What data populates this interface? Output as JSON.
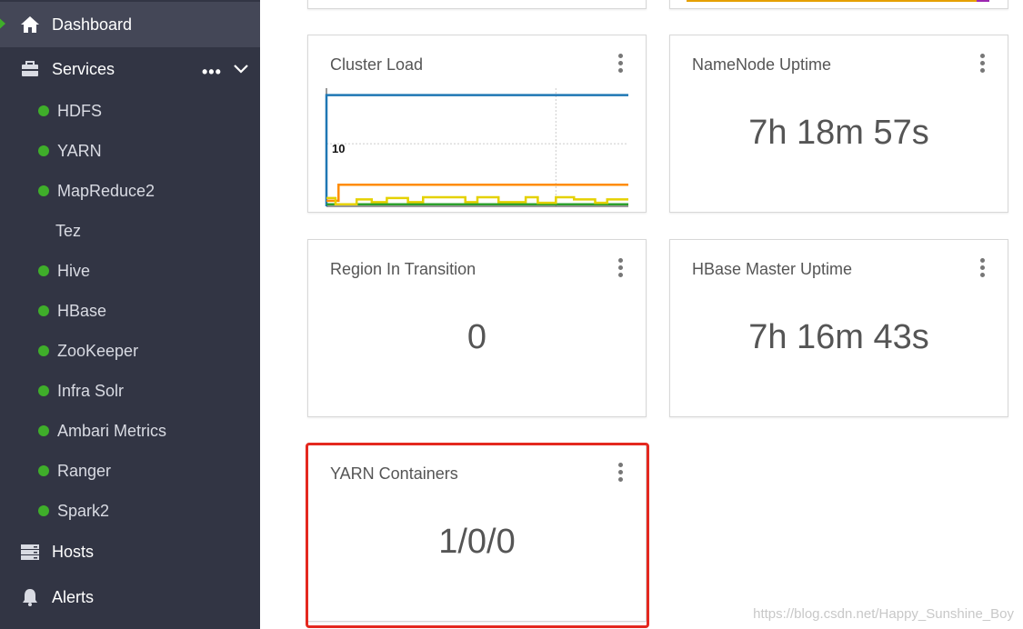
{
  "sidebar": {
    "dashboard": {
      "label": "Dashboard",
      "icon": "home-icon"
    },
    "services": {
      "label": "Services",
      "icon": "briefcase-icon",
      "more": "•••"
    },
    "service_items": [
      {
        "label": "HDFS",
        "status": "green"
      },
      {
        "label": "YARN",
        "status": "green"
      },
      {
        "label": "MapReduce2",
        "status": "green"
      },
      {
        "label": "Tez",
        "status": "none"
      },
      {
        "label": "Hive",
        "status": "green"
      },
      {
        "label": "HBase",
        "status": "green"
      },
      {
        "label": "ZooKeeper",
        "status": "green"
      },
      {
        "label": "Infra Solr",
        "status": "green"
      },
      {
        "label": "Ambari Metrics",
        "status": "green"
      },
      {
        "label": "Ranger",
        "status": "green"
      },
      {
        "label": "Spark2",
        "status": "green"
      }
    ],
    "hosts": {
      "label": "Hosts",
      "icon": "server-icon"
    },
    "alerts": {
      "label": "Alerts",
      "icon": "bell-icon"
    }
  },
  "widgets": {
    "cluster_load": {
      "title": "Cluster Load"
    },
    "namenode_uptime": {
      "title": "NameNode Uptime",
      "value": "7h 18m 57s"
    },
    "region_in_transition": {
      "title": "Region In Transition",
      "value": "0"
    },
    "hbase_master_uptime": {
      "title": "HBase Master Uptime",
      "value": "7h 16m 43s"
    },
    "yarn_containers": {
      "title": "YARN Containers",
      "value": "1/0/0"
    }
  },
  "chart_data": {
    "type": "line",
    "title": "Cluster Load",
    "tick_labels": [
      "10"
    ],
    "series": [
      {
        "color": "#1f77b4",
        "x": [
          0,
          0,
          1,
          100
        ],
        "y": [
          0,
          16,
          16,
          16
        ]
      },
      {
        "color": "#ff8c00",
        "x": [
          0,
          4,
          4,
          100
        ],
        "y": [
          0.8,
          0.8,
          3.1,
          3.1
        ]
      },
      {
        "color": "#2ca02c",
        "x": [
          0,
          100
        ],
        "y": [
          0.3,
          0.3
        ]
      },
      {
        "color": "#e5d100",
        "x": [
          0,
          3,
          3,
          10,
          10,
          15,
          15,
          20,
          20,
          27,
          27,
          32,
          32,
          46,
          46,
          50,
          50,
          57,
          57,
          66,
          66,
          70,
          70,
          76,
          76,
          82,
          82,
          89,
          89,
          93,
          93,
          100
        ],
        "y": [
          1.2,
          1.2,
          0.3,
          0.3,
          1.0,
          1.0,
          0.6,
          0.6,
          1.2,
          1.2,
          0.6,
          0.6,
          1.3,
          1.3,
          0.6,
          0.6,
          1.3,
          1.3,
          0.6,
          0.6,
          1.3,
          1.3,
          0.5,
          0.5,
          1.3,
          1.3,
          1.0,
          1.0,
          0.5,
          0.5,
          1.0,
          1.0
        ]
      }
    ],
    "grid": true
  },
  "watermark": "https://blog.csdn.net/Happy_Sunshine_Boy",
  "colors": {
    "sidebar_bg": "#323544",
    "active_bg": "#444757",
    "status_green": "#3fae2a",
    "highlight_red": "#e4281f"
  }
}
